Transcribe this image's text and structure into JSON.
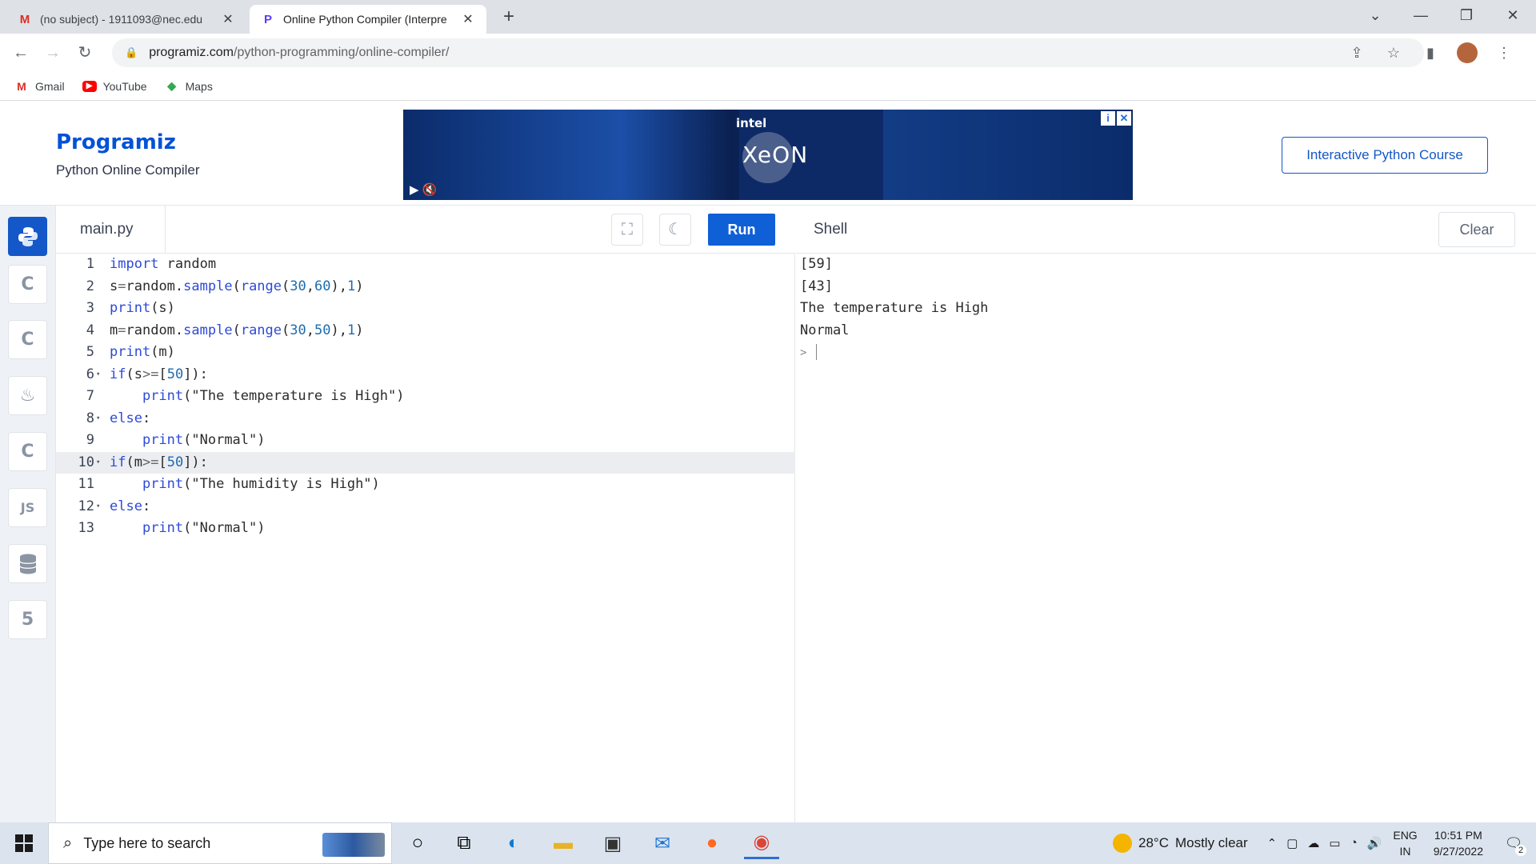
{
  "browser": {
    "tabs": [
      {
        "title": "(no subject) - 1911093@nec.edu",
        "favicon": "gmail-icon",
        "active": false
      },
      {
        "title": "Online Python Compiler (Interpre",
        "favicon": "programiz-icon",
        "active": true
      }
    ],
    "url_host": "programiz.com",
    "url_path": "/python-programming/online-compiler/",
    "bookmarks": [
      {
        "label": "Gmail",
        "icon": "gmail-icon"
      },
      {
        "label": "YouTube",
        "icon": "youtube-icon"
      },
      {
        "label": "Maps",
        "icon": "maps-icon"
      }
    ]
  },
  "header": {
    "logo": "Programiz",
    "subtitle": "Python Online Compiler",
    "course_button": "Interactive Python Course",
    "ad_brand": "intel",
    "ad_product": "XeON"
  },
  "sidebar": {
    "items": [
      {
        "name": "python",
        "label": "",
        "active": true
      },
      {
        "name": "c",
        "label": "C",
        "active": false
      },
      {
        "name": "cpp",
        "label": "C",
        "active": false
      },
      {
        "name": "java",
        "label": "♨",
        "active": false
      },
      {
        "name": "csharp",
        "label": "C",
        "active": false
      },
      {
        "name": "js",
        "label": "JS",
        "active": false
      },
      {
        "name": "sql",
        "label": "",
        "active": false
      },
      {
        "name": "html",
        "label": "5",
        "active": false
      }
    ]
  },
  "editor": {
    "file_name": "main.py",
    "run_label": "Run",
    "current_line": 10,
    "lines": [
      {
        "n": "1",
        "fold": false,
        "html": "<span class=\"kw\">import</span> random"
      },
      {
        "n": "2",
        "fold": false,
        "html": "s<span class=\"op\">=</span>random.<span class=\"fn\">sample</span>(<span class=\"fn\">range</span>(<span class=\"num\">30</span>,<span class=\"num\">60</span>),<span class=\"num\">1</span>)"
      },
      {
        "n": "3",
        "fold": false,
        "html": "<span class=\"fn\">print</span>(s)"
      },
      {
        "n": "4",
        "fold": false,
        "html": "m<span class=\"op\">=</span>random.<span class=\"fn\">sample</span>(<span class=\"fn\">range</span>(<span class=\"num\">30</span>,<span class=\"num\">50</span>),<span class=\"num\">1</span>)"
      },
      {
        "n": "5",
        "fold": false,
        "html": "<span class=\"fn\">print</span>(m)"
      },
      {
        "n": "6",
        "fold": true,
        "html": "<span class=\"kw\">if</span>(s<span class=\"op\">&gt;=</span>[<span class=\"num\">50</span>]):"
      },
      {
        "n": "7",
        "fold": false,
        "html": "    <span class=\"fn\">print</span>(\"The temperature is High\")"
      },
      {
        "n": "8",
        "fold": true,
        "html": "<span class=\"kw\">else</span>:"
      },
      {
        "n": "9",
        "fold": false,
        "html": "    <span class=\"fn\">print</span>(\"Normal\")"
      },
      {
        "n": "10",
        "fold": true,
        "html": "<span class=\"kw\">if</span>(m<span class=\"op\">&gt;=</span>[<span class=\"num\">50</span>]):"
      },
      {
        "n": "11",
        "fold": false,
        "html": "    <span class=\"fn\">print</span>(\"The humidity is High\")"
      },
      {
        "n": "12",
        "fold": true,
        "html": "<span class=\"kw\">else</span>:"
      },
      {
        "n": "13",
        "fold": false,
        "html": "    <span class=\"fn\">print</span>(\"Normal\")"
      }
    ]
  },
  "shell": {
    "title": "Shell",
    "clear_label": "Clear",
    "output": [
      "[59]",
      "[43]",
      "The temperature is High",
      "Normal"
    ],
    "prompt": ">"
  },
  "taskbar": {
    "search_placeholder": "Type here to search",
    "weather_temp": "28°C",
    "weather_desc": "Mostly clear",
    "lang": "ENG",
    "region": "IN",
    "time": "10:51 PM",
    "date": "9/27/2022",
    "notifications": "2"
  }
}
